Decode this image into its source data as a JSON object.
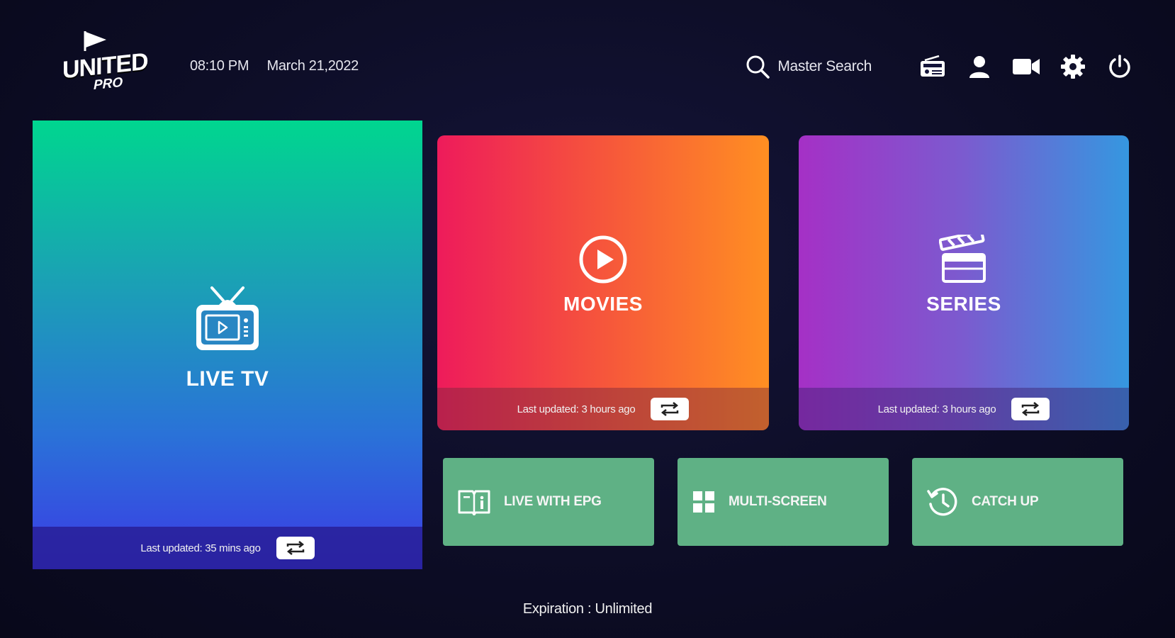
{
  "header": {
    "logo_text": "UNITED",
    "logo_sub": "PRO",
    "time": "08:10 PM",
    "date": "March 21,2022",
    "search_label": "Master Search",
    "icons": [
      "radio-icon",
      "user-icon",
      "video-camera-icon",
      "gear-icon",
      "power-icon"
    ]
  },
  "tiles": {
    "live": {
      "title": "LIVE TV",
      "updated": "Last updated: 35 mins ago"
    },
    "movies": {
      "title": "MOVIES",
      "updated": "Last updated: 3 hours ago"
    },
    "series": {
      "title": "SERIES",
      "updated": "Last updated: 3 hours ago"
    }
  },
  "shortcuts": {
    "epg": "LIVE WITH EPG",
    "multi": "MULTI-SCREEN",
    "catch": "CATCH UP"
  },
  "footer": {
    "expiration": "Expiration : Unlimited"
  },
  "colors": {
    "background": "#0b0b22",
    "shortcut_green": "#5fb185",
    "movies_start": "#ee1b5b",
    "movies_end": "#ff8f22",
    "series_start": "#a530c6",
    "series_end": "#3597e0",
    "live_top": "#00d68f",
    "live_bottom": "#3b3be5"
  }
}
